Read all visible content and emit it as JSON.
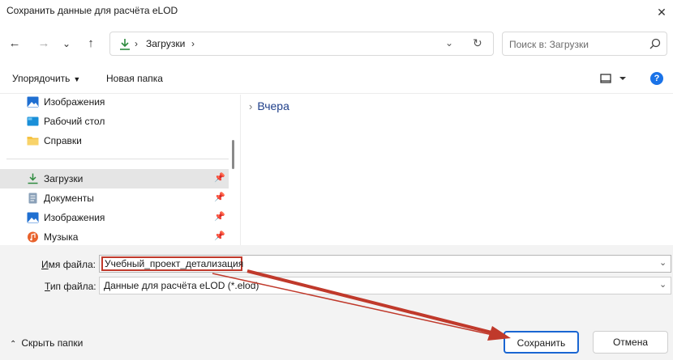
{
  "window": {
    "title": "Сохранить данные для расчёта eLOD",
    "close_glyph": "✕"
  },
  "nav_buttons": {
    "back": "←",
    "forward": "→",
    "history": "⌄",
    "up": "↑"
  },
  "address": {
    "breadcrumb": "Загрузки",
    "separator": "›",
    "dropdown_glyph": "⌄",
    "refresh_glyph": "↻"
  },
  "search": {
    "placeholder": "Поиск в: Загрузки"
  },
  "toolbar": {
    "organize": "Упорядочить",
    "organize_caret": "▼",
    "new_folder": "Новая папка",
    "help": "?"
  },
  "sidebar": {
    "items": [
      {
        "label": "Изображения",
        "icon": "images-icon",
        "pinned": false
      },
      {
        "label": "Рабочий стол",
        "icon": "desktop-icon",
        "pinned": false
      },
      {
        "label": "Справки",
        "icon": "folder-icon",
        "pinned": false
      },
      {
        "label": "Загрузки",
        "icon": "downloads-icon",
        "pinned": true,
        "selected": true
      },
      {
        "label": "Документы",
        "icon": "documents-icon",
        "pinned": true
      },
      {
        "label": "Изображения",
        "icon": "images-icon",
        "pinned": true
      },
      {
        "label": "Музыка",
        "icon": "music-icon",
        "pinned": true
      }
    ],
    "pin_glyph": "📌"
  },
  "content": {
    "group_label": "Вчера",
    "group_chevron": "›"
  },
  "form": {
    "filename_label_prefix": "И",
    "filename_label_rest": "мя файла:",
    "filename_value": "Учебный_проект_детализация",
    "filetype_label_prefix": "Т",
    "filetype_label_rest": "ип файла:",
    "filetype_value": "Данные для расчёта eLOD (*.elod)",
    "dropdown_glyph": "⌄"
  },
  "footer": {
    "hide_folders": "Скрыть папки",
    "hide_chevron": "⌃",
    "save": "Сохранить",
    "cancel": "Отмена"
  },
  "colors": {
    "accent": "#1a66d2",
    "annotation": "#c0392b",
    "folder": "#f5c242",
    "downloads": "#2e8b3e"
  }
}
